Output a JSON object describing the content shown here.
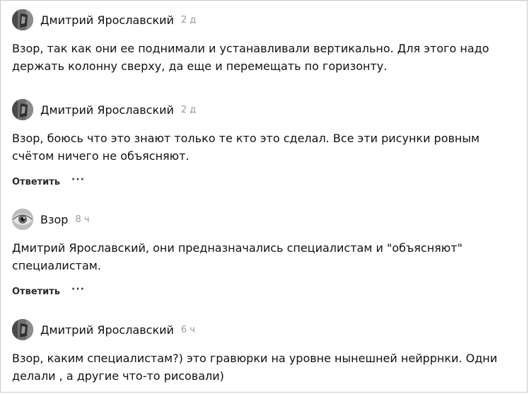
{
  "comments": [
    {
      "author": "Дмитрий Ярославский",
      "time": "2 д",
      "text": "Взор, так как они ее поднимали и устанавливали вертикально. Для этого надо держать колонну сверху, да еще и перемещать по горизонту.",
      "avatar_icon": "portrait-avatar-icon"
    },
    {
      "author": "Дмитрий Ярославский",
      "time": "2 д",
      "text": "Взор, боюсь что это знают только те кто это сделал. Все эти рисунки ровным счётом ничего не объясняют.",
      "reply_label": "Ответить",
      "more_label": "···",
      "avatar_icon": "portrait-avatar-icon"
    },
    {
      "author": "Взор",
      "time": "8 ч",
      "text": "Дмитрий Ярославский, они предназначались специалистам и \"объясняют\" специалистам.",
      "reply_label": "Ответить",
      "more_label": "···",
      "avatar_icon": "eye-avatar-icon"
    },
    {
      "author": "Дмитрий Ярославский",
      "time": "6 ч",
      "text": "Взор, каким специалистам?) это гравюрки на уровне нынешней нейррнки. Одни делали , а другие что-то рисовали)",
      "avatar_icon": "portrait-avatar-icon"
    }
  ],
  "colors": {
    "text": "#111111",
    "time": "#9a9a9a",
    "border": "#c9c9c9"
  }
}
